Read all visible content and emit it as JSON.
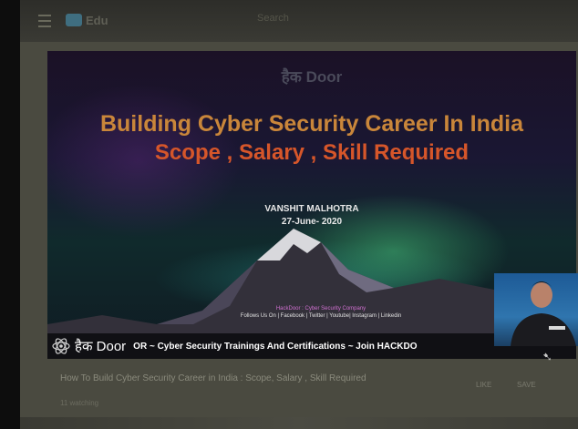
{
  "header": {
    "logo_text": "Edu",
    "search_placeholder": "Search"
  },
  "video": {
    "brand_top": "हैक Door",
    "title_line1": "Building Cyber Security Career In India",
    "title_line2": "Scope , Salary , Skill Required",
    "author": "VANSHIT MALHOTRA",
    "date": "27-June- 2020",
    "company_line": "HackDoor : Cyber Security Company",
    "socials_line": "Follows Us On | Facebook | Twitter | Youtube| Instagram | Linkedin",
    "ticker_brand": "हैक Door",
    "ticker_text": "OR ~ Cyber Security Trainings And Certifications  ~ Join HACKDO"
  },
  "below_video": {
    "caption": "How To Build Cyber Security Career in India : Scope, Salary , Skill Required",
    "views": "11 watching",
    "like_label": "LIKE",
    "save_label": "SAVE"
  },
  "colors": {
    "title1": "#c9863a",
    "title2": "#d6562a",
    "ticker_bg": "#101014"
  }
}
